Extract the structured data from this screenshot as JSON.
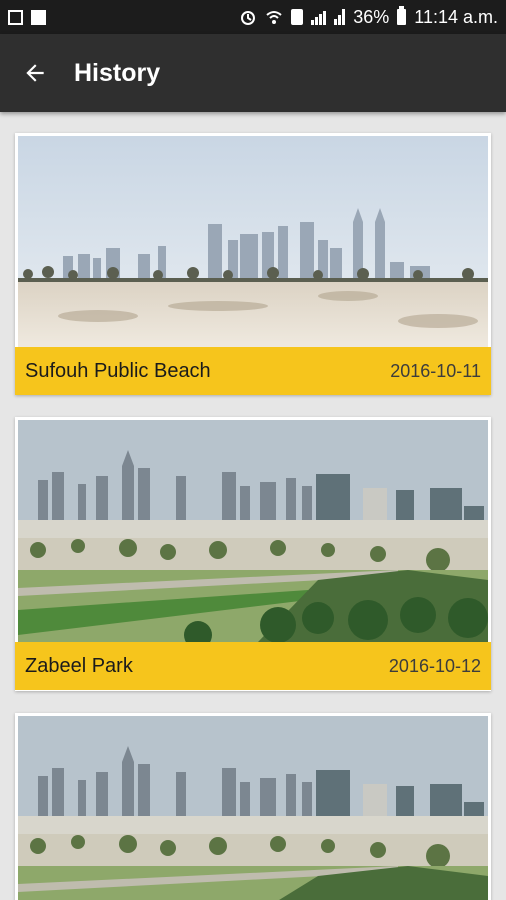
{
  "status_bar": {
    "battery": "36%",
    "time": "11:14 a.m."
  },
  "app_bar": {
    "title": "History",
    "back_icon": "arrow-back-icon"
  },
  "history": [
    {
      "place": "Sufouh Public Beach",
      "date": "2016-10-11",
      "scene": "desert-skyline"
    },
    {
      "place": "Zabeel Park",
      "date": "2016-10-12",
      "scene": "park-skyline"
    },
    {
      "place": "",
      "date": "",
      "scene": "park-skyline"
    }
  ],
  "colors": {
    "status_bar": "#1c1c1c",
    "app_bar": "#2f2f2f",
    "accent": "#f6c51c",
    "background": "#e6e6e6"
  }
}
